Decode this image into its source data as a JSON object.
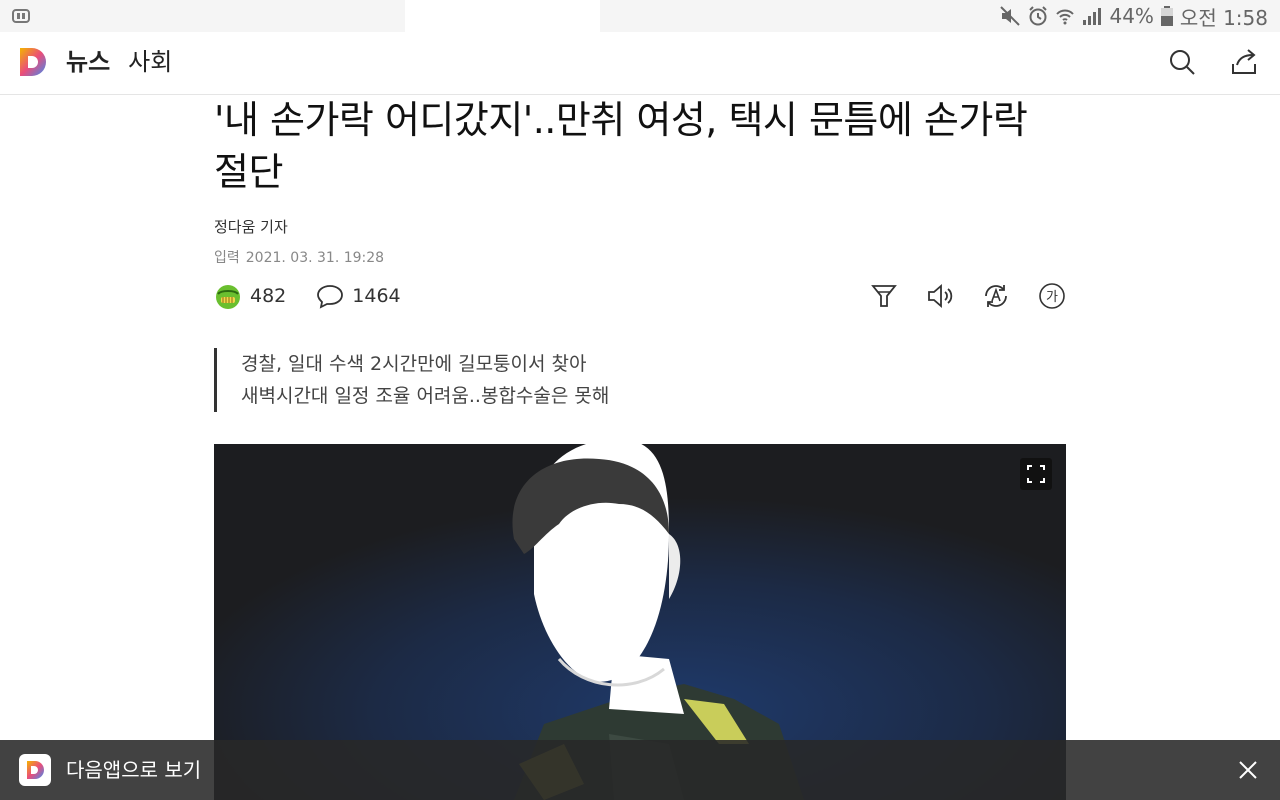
{
  "status_bar": {
    "battery": "44%",
    "time": "오전 1:58",
    "icons": [
      "mute-icon",
      "alarm-icon",
      "wifi-icon",
      "signal-icon",
      "battery-icon"
    ]
  },
  "header": {
    "section": "뉴스",
    "category": "사회",
    "icons": [
      "search-icon",
      "share-icon"
    ]
  },
  "article": {
    "headline": "'내 손가락 어디갔지'..만취 여성, 택시 문틈에 손가락 절단",
    "reporter": "정다움 기자",
    "date_label": "입력",
    "date": "2021. 03. 31. 19:28",
    "reaction_count": "482",
    "comment_count": "1464",
    "tool_icons": [
      "filter-icon",
      "speaker-icon",
      "translate-icon",
      "font-size-icon"
    ],
    "font_size_glyph": "가",
    "summary": [
      "경찰, 일대 수색 2시간만에 길모퉁이서 찾아",
      "새벽시간대 일정 조율 어려움..봉합수술은 못해"
    ]
  },
  "app_banner": {
    "text": "다음앱으로 보기"
  },
  "colors": {
    "brand_gradient": [
      "#f4b400",
      "#ea4d7a",
      "#3f8cf0"
    ],
    "banner_bg": "#282828"
  }
}
